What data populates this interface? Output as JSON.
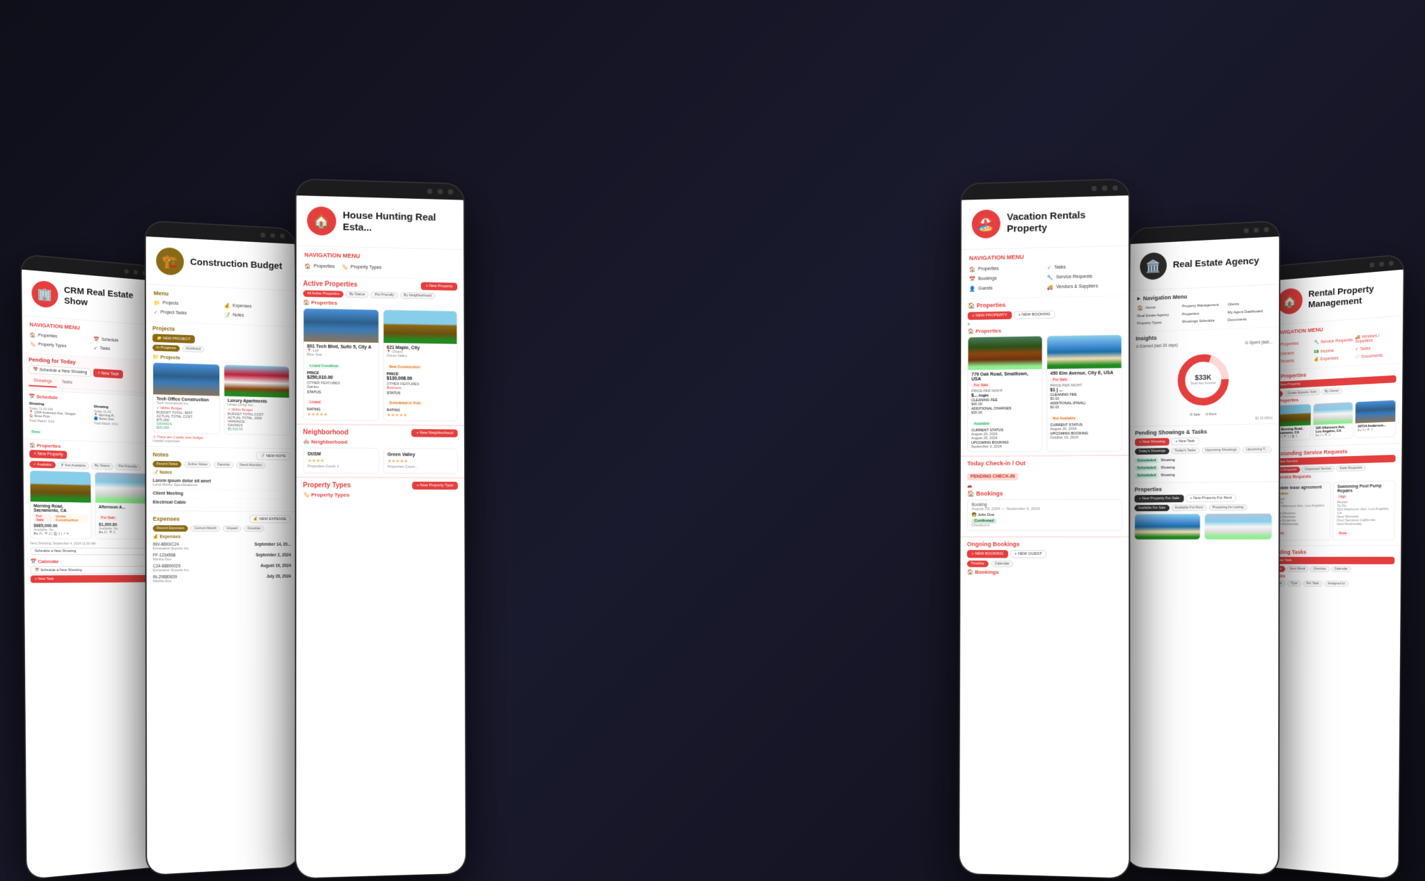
{
  "scene": {
    "background": "#1a1a2e"
  },
  "tablets": [
    {
      "id": "tablet-1",
      "title": "CRM Real Estate Show",
      "logo_color": "#e53e3e",
      "logo_icon": "🏢",
      "nav_title": "Navigation Menu",
      "nav_items": [
        {
          "label": "Properties",
          "icon": "🏠"
        },
        {
          "label": "Schedule",
          "icon": "📅"
        },
        {
          "label": "Property Types",
          "icon": "🏷️"
        },
        {
          "label": "Tasks",
          "icon": "✓"
        }
      ],
      "sections": [
        {
          "type": "pending",
          "title": "Pending for Today"
        },
        {
          "type": "schedule"
        },
        {
          "type": "properties"
        }
      ]
    },
    {
      "id": "tablet-2",
      "title": "Construction Budget",
      "logo_color": "#8B6914",
      "logo_icon": "🏗️",
      "nav_items": [
        {
          "label": "Projects",
          "icon": "📁"
        },
        {
          "label": "Expenses",
          "icon": "💰"
        },
        {
          "label": "Project Tasks",
          "icon": "✓"
        },
        {
          "label": "Notes",
          "icon": "📝"
        }
      ],
      "sections": [
        {
          "type": "projects"
        },
        {
          "type": "notes"
        },
        {
          "type": "expenses"
        }
      ]
    },
    {
      "id": "tablet-3",
      "title": "House Hunting Real Esta",
      "logo_color": "#e53e3e",
      "logo_icon": "🏠",
      "nav_items": [
        {
          "label": "Properties",
          "icon": "🏠"
        },
        {
          "label": "Property Types",
          "icon": "🏷️"
        }
      ],
      "sections": [
        {
          "type": "active_properties"
        },
        {
          "type": "neighborhood"
        }
      ]
    },
    {
      "id": "tablet-4",
      "title": "Vacation Rentals Property",
      "logo_color": "#e53e3e",
      "logo_icon": "🏖️",
      "nav_items": [
        {
          "label": "Properties",
          "icon": "🏠"
        },
        {
          "label": "Tasks",
          "icon": "✓"
        },
        {
          "label": "Bookings",
          "icon": "📅"
        },
        {
          "label": "Service Requests",
          "icon": "🔧"
        },
        {
          "label": "Guests",
          "icon": "👤"
        },
        {
          "label": "Vendors & Suppliers",
          "icon": "🚚"
        }
      ],
      "sections": [
        {
          "type": "vacation_properties"
        },
        {
          "type": "checkin"
        },
        {
          "type": "ongoing_bookings"
        }
      ]
    },
    {
      "id": "tablet-5",
      "title": "Real Estate Agency",
      "logo_color": "#2d2d2d",
      "logo_icon": "🏛️",
      "nav_items": [
        {
          "label": "Home",
          "icon": "🏠"
        },
        {
          "label": "Real Estate Agency",
          "icon": "🏢"
        },
        {
          "label": "My Agent Dashboard",
          "icon": "📊"
        },
        {
          "label": "Property Management",
          "icon": "🏗️"
        },
        {
          "label": "Properties",
          "icon": "🏠"
        },
        {
          "label": "Property Types",
          "icon": "🏷️"
        },
        {
          "label": "Showings Schedule",
          "icon": "📅"
        },
        {
          "label": "Documents",
          "icon": "📄"
        },
        {
          "label": "Clients",
          "icon": "👤"
        }
      ],
      "sections": [
        {
          "type": "insights"
        },
        {
          "type": "pending_showings"
        },
        {
          "type": "agency_properties"
        }
      ]
    },
    {
      "id": "tablet-6",
      "title": "Rental Property Management",
      "logo_color": "#e53e3e",
      "logo_icon": "🏠",
      "nav_items": [
        {
          "label": "Properties",
          "icon": "🏠"
        },
        {
          "label": "Service Requests",
          "icon": "🔧"
        },
        {
          "label": "Vendors / Suppliers",
          "icon": "🚚"
        },
        {
          "label": "Owners",
          "icon": "👤"
        },
        {
          "label": "Income",
          "icon": "💵"
        },
        {
          "label": "Tasks",
          "icon": "✓"
        },
        {
          "label": "Tenants",
          "icon": "👥"
        },
        {
          "label": "Expenses",
          "icon": "💰"
        },
        {
          "label": "Documents",
          "icon": "📄"
        }
      ],
      "sections": [
        {
          "type": "rental_properties"
        },
        {
          "type": "service_requests"
        },
        {
          "type": "pending_tasks"
        }
      ]
    }
  ]
}
